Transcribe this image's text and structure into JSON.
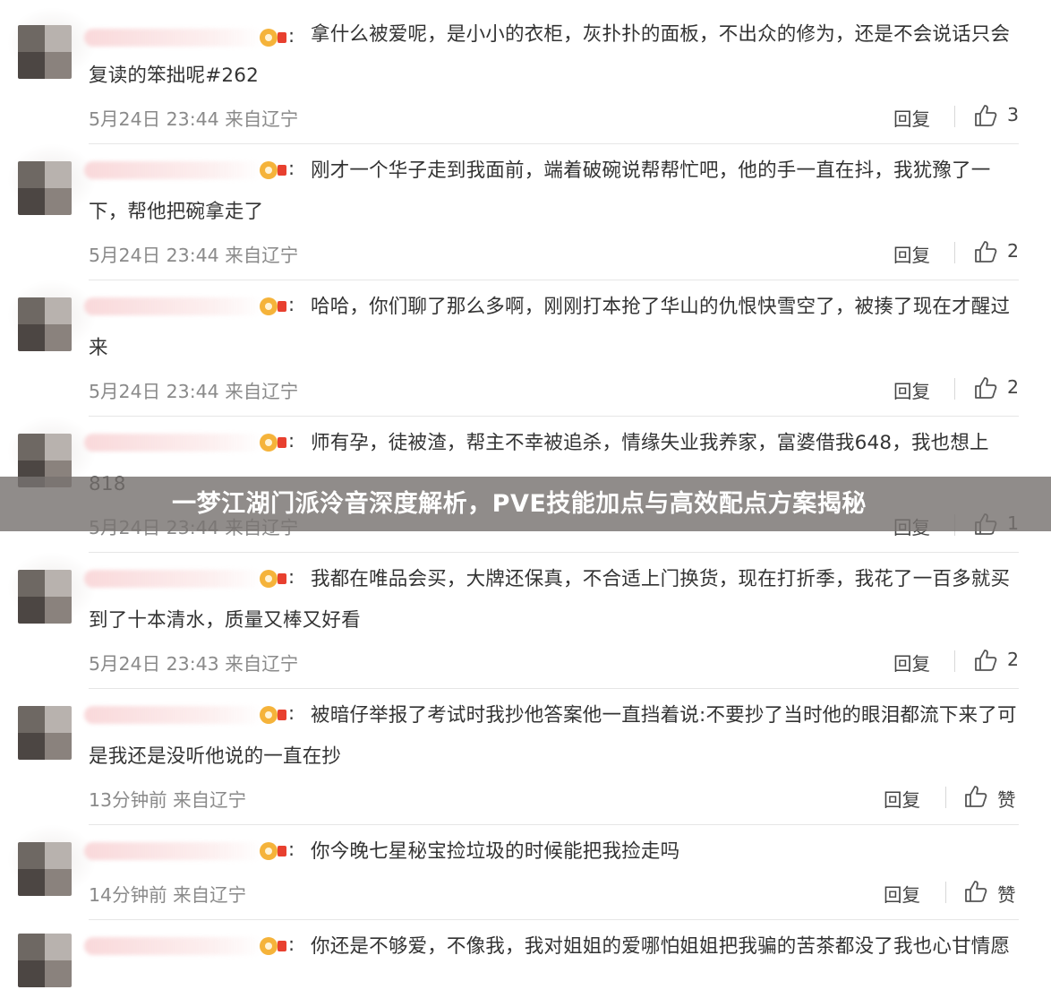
{
  "banner": {
    "title": "一梦江湖门派泠音深度解析，PVE技能加点与高效配点方案揭秘"
  },
  "comments": [
    {
      "text": "拿什么被爱呢，是小小的衣柜，灰扑扑的面板，不出众的修为，还是不会说话只会复读的笨拙呢#262",
      "meta": "5月24日 23:44 来自辽宁",
      "reply": "回复",
      "likes": "3"
    },
    {
      "text": "刚才一个华子走到我面前，端着破碗说帮帮忙吧，他的手一直在抖，我犹豫了一下，帮他把碗拿走了",
      "meta": "5月24日 23:44 来自辽宁",
      "reply": "回复",
      "likes": "2"
    },
    {
      "text": "哈哈，你们聊了那么多啊，刚刚打本抢了华山的仇恨快雪空了，被揍了现在才醒过来",
      "meta": "5月24日 23:44 来自辽宁",
      "reply": "回复",
      "likes": "2"
    },
    {
      "text": "师有孕，徒被渣，帮主不幸被追杀，情缘失业我养家，富婆借我648，我也想上818",
      "meta": "5月24日 23:44 来自辽宁",
      "reply": "回复",
      "likes": "1"
    },
    {
      "text": "我都在唯品会买，大牌还保真，不合适上门换货，现在打折季，我花了一百多就买到了十本清水，质量又棒又好看",
      "meta": "5月24日 23:43 来自辽宁",
      "reply": "回复",
      "likes": "2"
    },
    {
      "text": "被暗仔举报了考试时我抄他答案他一直挡着说:不要抄了当时他的眼泪都流下来了可是我还是没听他说的一直在抄",
      "meta": "13分钟前 来自辽宁",
      "reply": "回复",
      "likes": "赞"
    },
    {
      "text": "你今晚七星秘宝捡垃圾的时候能把我捡走吗",
      "meta": "14分钟前 来自辽宁",
      "reply": "回复",
      "likes": "赞"
    },
    {
      "text": "你还是不够爱，不像我，我对姐姐的爱哪怕姐姐把我骗的苦茶都没了我也心甘情愿",
      "meta": "",
      "reply": "",
      "likes": ""
    }
  ]
}
